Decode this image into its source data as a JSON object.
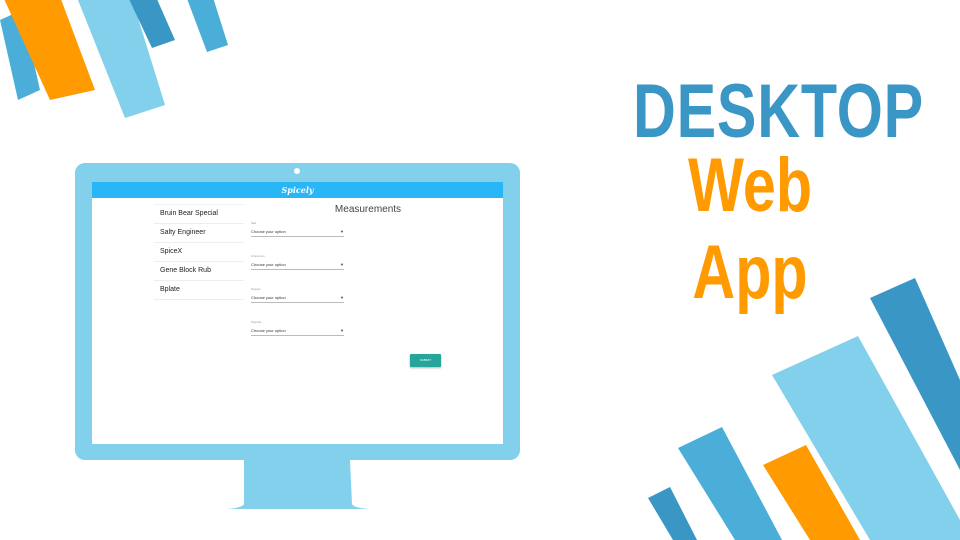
{
  "slide": {
    "title_line1": "DESKTOP",
    "title_line2": "Web App"
  },
  "colors": {
    "title_blue": "#3a96c4",
    "title_orange": "#ff9a00",
    "monitor": "#82d0ec",
    "appbar": "#29b6f6",
    "submit": "#26a69a"
  },
  "app": {
    "brand": "Spicely",
    "sidebar": {
      "items": [
        {
          "label": "Bruin Bear Special"
        },
        {
          "label": "Salty Engineer"
        },
        {
          "label": "SpiceX"
        },
        {
          "label": "Gene Block Rub"
        },
        {
          "label": "Bplate"
        }
      ]
    },
    "main": {
      "title": "Measurements",
      "fields": [
        {
          "label": "Salt",
          "value": "Choose your option"
        },
        {
          "label": "Cinnamon",
          "value": "Choose your option"
        },
        {
          "label": "Pepper",
          "value": "Choose your option"
        },
        {
          "label": "Paprika",
          "value": "Choose your option"
        }
      ],
      "submit_label": "SUBMIT"
    }
  }
}
